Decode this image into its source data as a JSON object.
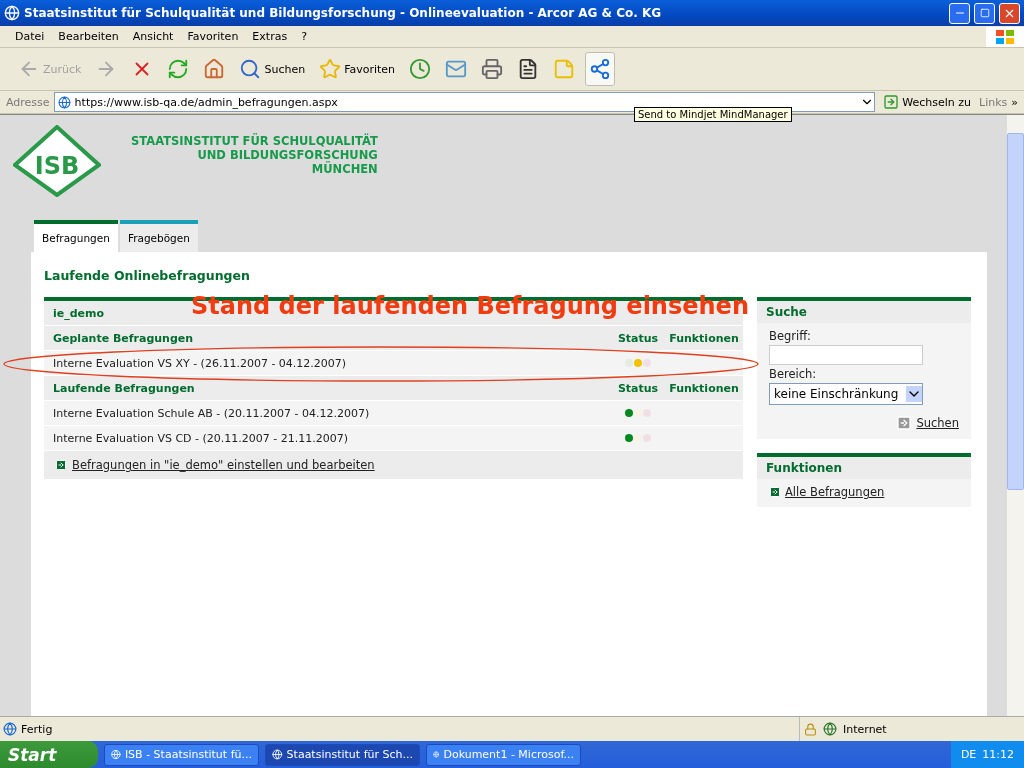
{
  "window": {
    "title": "Staatsinstitut für Schulqualität und Bildungsforschung - Onlineevaluation - Arcor AG & Co. KG"
  },
  "menu": [
    "Datei",
    "Bearbeiten",
    "Ansicht",
    "Favoriten",
    "Extras",
    "?"
  ],
  "toolbar": [
    {
      "kind": "back",
      "label": "Zurück",
      "disabled": true
    },
    {
      "kind": "forward",
      "disabled": true
    },
    {
      "kind": "stop"
    },
    {
      "kind": "refresh"
    },
    {
      "kind": "home"
    },
    {
      "kind": "search",
      "label": "Suchen"
    },
    {
      "kind": "favorites",
      "label": "Favoriten"
    },
    {
      "kind": "history"
    },
    {
      "kind": "mail"
    },
    {
      "kind": "print"
    },
    {
      "kind": "word"
    },
    {
      "kind": "note"
    },
    {
      "kind": "mindmap",
      "selected": true
    }
  ],
  "address": {
    "label": "Adresse",
    "url": "https://www.isb-qa.de/admin_befragungen.aspx",
    "go": "Wechseln zu",
    "links": "Links",
    "more": "»"
  },
  "tooltip": "Send to Mindjet MindManager",
  "page": {
    "logo": "ISB",
    "institute": [
      "STAATSINSTITUT FÜR SCHULQUALITÄT",
      "UND BILDUNGSFORSCHUNG",
      "MÜNCHEN"
    ],
    "tabs": [
      {
        "label": "Befragungen",
        "selected": true
      },
      {
        "label": "Fragebögen",
        "selected": false
      }
    ],
    "heading": "Laufende Onlinebefragungen",
    "group": {
      "name": "ie_demo",
      "sections": [
        {
          "title": "Geplante Befragungen",
          "status_header": "Status",
          "functions_header": "Funktionen",
          "rows": [
            {
              "text": "Interne Evaluation VS XY - (26.11.2007 - 04.12.2007)",
              "lamps": [
                {
                  "color": "#e3ebe3"
                },
                {
                  "color": "#f2c200"
                },
                {
                  "color": "#f0e0e4"
                }
              ]
            }
          ]
        },
        {
          "title": "Laufende Befragungen",
          "status_header": "Status",
          "functions_header": "Funktionen",
          "rows": [
            {
              "text": "Interne Evaluation Schule AB - (20.11.2007 - 04.12.2007)",
              "lamps": [
                {
                  "color": "#008a1e"
                },
                {
                  "color": "#f6f2e4"
                },
                {
                  "color": "#f0e0e4"
                }
              ]
            },
            {
              "text": "Interne Evaluation VS CD - (20.11.2007 - 21.11.2007)",
              "lamps": [
                {
                  "color": "#008a1e"
                },
                {
                  "color": "#f6f2e4"
                },
                {
                  "color": "#f0e0e4"
                }
              ]
            }
          ]
        }
      ],
      "link": "Befragungen in \"ie_demo\" einstellen und bearbeiten"
    },
    "search_panel": {
      "title": "Suche",
      "term_label": "Begriff:",
      "area_label": "Bereich:",
      "area_value": "keine Einschränkung",
      "button": "Suchen"
    },
    "functions_panel": {
      "title": "Funktionen",
      "link": "Alle Befragungen"
    }
  },
  "annotation": "Stand der laufenden Befragung einsehen",
  "status_bar": {
    "text": "Fertig",
    "zone": "Internet"
  },
  "taskbar": {
    "start": "Start",
    "tasks": [
      {
        "label": "ISB - Staatsinstitut fü...",
        "selected": false
      },
      {
        "label": "Staatsinstitut für Sch...",
        "selected": true
      },
      {
        "label": "Dokument1 - Microsof...",
        "selected": false
      }
    ],
    "language": "DE",
    "clock": "11:12"
  }
}
